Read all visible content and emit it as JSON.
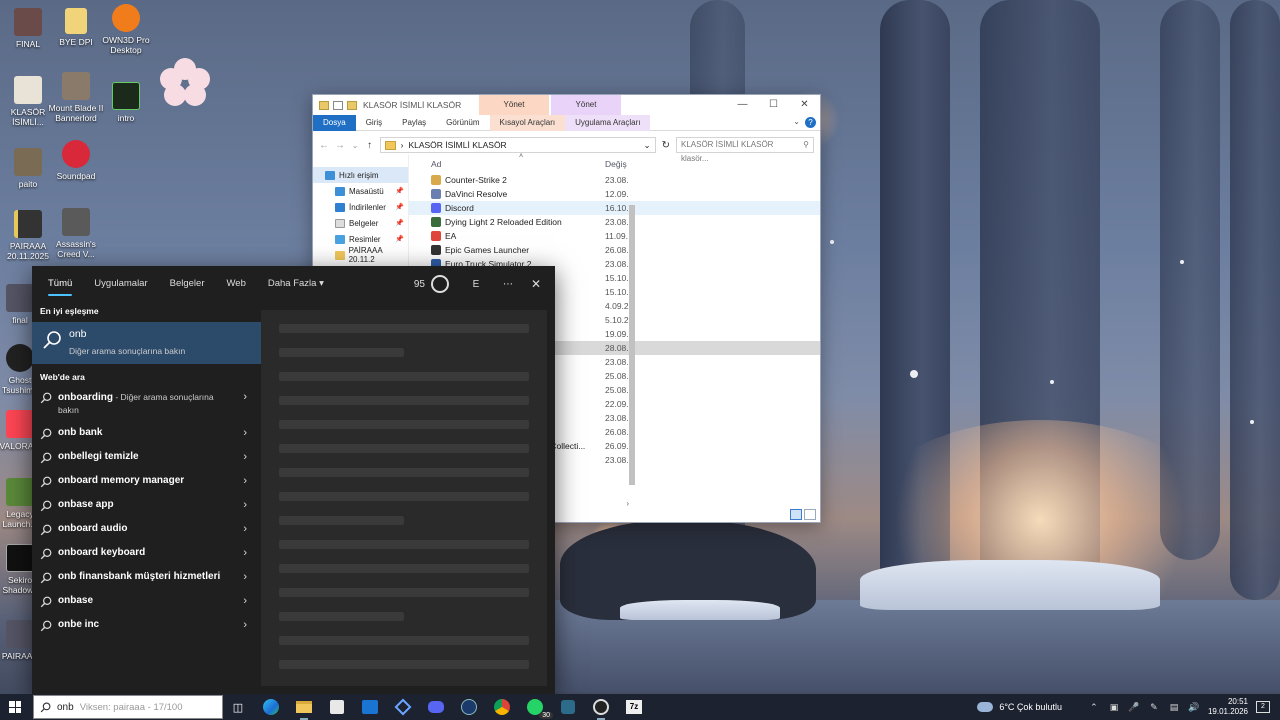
{
  "desktop_icons": [
    {
      "label": "FINAL"
    },
    {
      "label": "BYE DPI"
    },
    {
      "label": "OWN3D Pro Desktop"
    },
    {
      "label": "KLASÖR İSİMLİ..."
    },
    {
      "label": "Mount Blade II Bannerlord"
    },
    {
      "label": "intro"
    },
    {
      "label": "paito"
    },
    {
      "label": "Soundpad"
    },
    {
      "label": "PAIRAAA 20.11.2025"
    },
    {
      "label": "Assassin's Creed V..."
    },
    {
      "label": "final"
    },
    {
      "label": "Ghost Tsushima"
    },
    {
      "label": "VALORA..."
    },
    {
      "label": "Legacy Launch..."
    },
    {
      "label": "Sekiro Shadows"
    },
    {
      "label": "PAIRAAA"
    }
  ],
  "explorer": {
    "title": "KLASÖR İSİMLİ KLASÖR",
    "context_tab_a": "Yönet",
    "context_tab_b": "Yönet",
    "ribbon_tabs": [
      "Dosya",
      "Giriş",
      "Paylaş",
      "Görünüm",
      "Kısayol Araçları",
      "Uygulama Araçları"
    ],
    "address": "KLASÖR İSİMLİ KLASÖR",
    "search_placeholder": "KLASÖR İSİMLİ KLASÖR klasör...",
    "nav_items": [
      {
        "label": "Hızlı erişim",
        "selected": true,
        "pinned": false
      },
      {
        "label": "Masaüstü",
        "selected": false,
        "pinned": true
      },
      {
        "label": "İndirilenler",
        "selected": false,
        "pinned": true
      },
      {
        "label": "Belgeler",
        "selected": false,
        "pinned": true
      },
      {
        "label": "Resimler",
        "selected": false,
        "pinned": true
      },
      {
        "label": "PAİRAAA 20.11.2",
        "selected": false,
        "pinned": false
      }
    ],
    "columns": {
      "name": "Ad",
      "date": "Değiş"
    },
    "files": [
      {
        "name": "Counter-Strike 2",
        "date": "23.08.",
        "color": "#d8a94a"
      },
      {
        "name": "DaVinci Resolve",
        "date": "12.09.",
        "color": "#6a7fb0"
      },
      {
        "name": "Discord",
        "date": "16.10.",
        "color": "#5865f2"
      },
      {
        "name": "Dying Light 2 Reloaded Edition",
        "date": "23.08.",
        "color": "#3a6b3a"
      },
      {
        "name": "EA",
        "date": "11.09.",
        "color": "#e0463c"
      },
      {
        "name": "Epic Games Launcher",
        "date": "26.08.",
        "color": "#333333"
      },
      {
        "name": "Euro Truck Simulator 2",
        "date": "23.08.",
        "color": "#2f5fa8"
      }
    ],
    "extra_dates": [
      "15.10.",
      "15.10.",
      "4.09.2",
      "5.10.2",
      "19.09.",
      "28.08.",
      "23.08.",
      "25.08.",
      "25.08.",
      "22.09.",
      "23.08.",
      "26.08.",
      "26.09.",
      "23.08."
    ],
    "partial_name": "es Collecti..."
  },
  "search_panel": {
    "tabs": [
      "Tümü",
      "Uygulamalar",
      "Belgeler",
      "Web",
      "Daha Fazla"
    ],
    "points": "95",
    "avatar_letter": "E",
    "best_match_title": "En iyi eşleşme",
    "best_match_query": "onb",
    "best_match_sub": "Diğer arama sonuçlarına bakın",
    "web_title": "Web'de ara",
    "web_results": [
      {
        "bold": "onboarding",
        "rest": " - Diğer arama sonuçlarına bakın"
      },
      {
        "bold": "onb bank",
        "rest": ""
      },
      {
        "bold": "onbellegi temizle",
        "rest": ""
      },
      {
        "bold": "onboard memory manager",
        "rest": ""
      },
      {
        "bold": "onbase app",
        "rest": ""
      },
      {
        "bold": "onboard audio",
        "rest": ""
      },
      {
        "bold": "onboard keyboard",
        "rest": ""
      },
      {
        "bold": "onb finansbank müşteri hizmetleri",
        "rest": ""
      },
      {
        "bold": "onbase",
        "rest": ""
      },
      {
        "bold": "onbe inc",
        "rest": ""
      }
    ]
  },
  "taskbar": {
    "search_text": "onb",
    "search_ghost": "Viksen: pairaaa - 17/100",
    "whatsapp_badge": "30",
    "weather": "6°C  Çok bulutlu",
    "time": "20:51",
    "date": "19.01.2026",
    "notifications": "2",
    "app_icons": [
      "task-view",
      "edge",
      "file-explorer",
      "store",
      "outlook",
      "vpn",
      "discord",
      "steam",
      "chrome",
      "whatsapp",
      "snipping",
      "obs",
      "7zip"
    ]
  }
}
